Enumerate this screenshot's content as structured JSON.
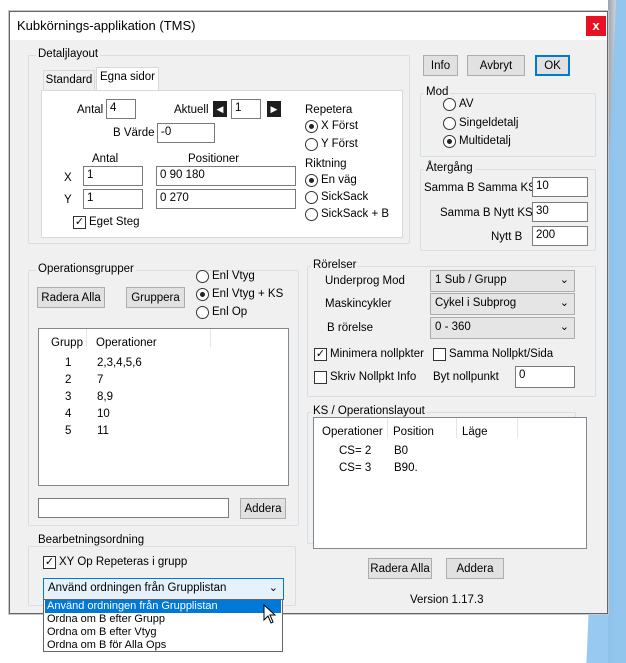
{
  "window": {
    "title": "Kubkörnings-applikation (TMS)",
    "close": "x"
  },
  "detail": {
    "group_label": "Detaljlayout",
    "tabs": [
      "Standard",
      "Egna sidor"
    ],
    "antal_label": "Antal",
    "antal_value": "4",
    "aktuell_label": "Aktuell",
    "aktuell_value": "1",
    "bvarde_label": "B Värde",
    "bvarde_value": "-0",
    "col_antal": "Antal",
    "col_positioner": "Positioner",
    "x_label": "X",
    "x_antal": "1",
    "x_pos": "0 90 180",
    "y_label": "Y",
    "y_antal": "1",
    "y_pos": "0 270",
    "eget_steg": "Eget Steg",
    "repetera_label": "Repetera",
    "repetera_options": [
      "X Först",
      "Y Först"
    ],
    "riktning_label": "Riktning",
    "riktning_options": [
      "En väg",
      "SickSack",
      "SickSack + B"
    ]
  },
  "buttons": {
    "info": "Info",
    "avbryt": "Avbryt",
    "ok": "OK"
  },
  "mod": {
    "label": "Mod",
    "options": [
      "AV",
      "Singeldetalj",
      "Multidetalj"
    ]
  },
  "atergang": {
    "label": "Återgång",
    "rows": [
      {
        "label": "Samma B Samma KS",
        "value": "10"
      },
      {
        "label": "Samma B Nytt KS",
        "value": "30"
      },
      {
        "label": "Nytt B",
        "value": "200"
      }
    ]
  },
  "opgroups": {
    "label": "Operationsgrupper",
    "radera_alla": "Radera Alla",
    "gruppera": "Gruppera",
    "radio_options": [
      "Enl Vtyg",
      "Enl Vtyg + KS",
      "Enl Op"
    ],
    "columns": [
      "Grupp",
      "Operationer"
    ],
    "rows": [
      {
        "grupp": "1",
        "ops": "2,3,4,5,6"
      },
      {
        "grupp": "2",
        "ops": "7"
      },
      {
        "grupp": "3",
        "ops": "8,9"
      },
      {
        "grupp": "4",
        "ops": "10"
      },
      {
        "grupp": "5",
        "ops": "11"
      }
    ],
    "input_value": "",
    "addera": "Addera"
  },
  "rorelser": {
    "label": "Rörelser",
    "underprog_label": "Underprog Mod",
    "underprog_value": "1 Sub / Grupp",
    "maskin_label": "Maskincykler",
    "maskin_value": "Cykel i Subprog",
    "brorelse_label": "B rörelse",
    "brorelse_value": "0 - 360",
    "minimera": "Minimera nollpkter",
    "samma_nollpkt": "Samma Nollpkt/Sida",
    "skriv_nollpkt": "Skriv Nollpkt Info",
    "byt_label": "Byt nollpunkt",
    "byt_value": "0"
  },
  "ks": {
    "label": "KS / Operationslayout",
    "columns": [
      "Operationer",
      "Position",
      "Läge"
    ],
    "rows": [
      {
        "op": "CS= 2",
        "pos": "B0",
        "lage": ""
      },
      {
        "op": "CS= 3",
        "pos": "B90.",
        "lage": ""
      }
    ],
    "radera_alla": "Radera Alla",
    "addera": "Addera"
  },
  "bearb": {
    "label": "Bearbetningsordning",
    "xy_repeat": "XY Op Repeteras i grupp",
    "selected": "Använd ordningen från Grupplistan",
    "options": [
      "Använd ordningen från Grupplistan",
      "Ordna om B efter Grupp",
      "Ordna om B efter Vtyg",
      "Ordna om B för Alla Ops"
    ]
  },
  "version": "Version 1.17.3"
}
